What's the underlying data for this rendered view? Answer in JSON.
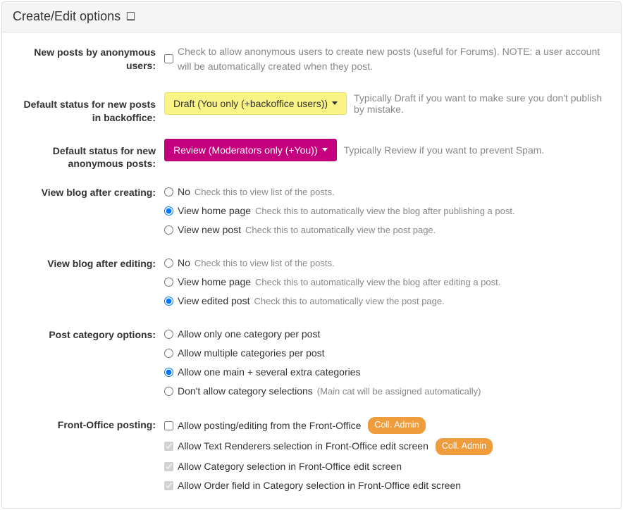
{
  "panel": {
    "title": "Create/Edit options"
  },
  "anon": {
    "label": "New posts by anonymous users:",
    "checked": false,
    "hint": "Check to allow anonymous users to create new posts (useful for Forums). NOTE: a user account will be automatically created when they post."
  },
  "backoffice_status": {
    "label": "Default status for new posts in backoffice:",
    "button": "Draft (You only (+backoffice users))",
    "hint": "Typically Draft if you want to make sure you don't publish by mistake."
  },
  "anon_status": {
    "label": "Default status for new anonymous posts:",
    "button": "Review (Moderators only (+You))",
    "hint": "Typically Review if you want to prevent Spam."
  },
  "view_create": {
    "label": "View blog after creating:",
    "opts": [
      {
        "label": "No",
        "hint": "Check this to view list of the posts.",
        "checked": false
      },
      {
        "label": "View home page",
        "hint": "Check this to automatically view the blog after publishing a post.",
        "checked": true
      },
      {
        "label": "View new post",
        "hint": "Check this to automatically view the post page.",
        "checked": false
      }
    ]
  },
  "view_edit": {
    "label": "View blog after editing:",
    "opts": [
      {
        "label": "No",
        "hint": "Check this to view list of the posts.",
        "checked": false
      },
      {
        "label": "View home page",
        "hint": "Check this to automatically view the blog after editing a post.",
        "checked": false
      },
      {
        "label": "View edited post",
        "hint": "Check this to automatically view the post page.",
        "checked": true
      }
    ]
  },
  "category": {
    "label": "Post category options:",
    "opts": [
      {
        "label": "Allow only one category per post",
        "hint": "",
        "checked": false
      },
      {
        "label": "Allow multiple categories per post",
        "hint": "",
        "checked": false
      },
      {
        "label": "Allow one main + several extra categories",
        "hint": "",
        "checked": true
      },
      {
        "label": "Don't allow category selections",
        "hint": "(Main cat will be assigned automatically)",
        "checked": false
      }
    ]
  },
  "front": {
    "label": "Front-Office posting:",
    "badge": "Coll. Admin",
    "opts": [
      {
        "label": "Allow posting/editing from the Front-Office",
        "checked": false,
        "disabled": false,
        "badge": true
      },
      {
        "label": "Allow Text Renderers selection in Front-Office edit screen",
        "checked": true,
        "disabled": true,
        "badge": true
      },
      {
        "label": "Allow Category selection in Front-Office edit screen",
        "checked": true,
        "disabled": true,
        "badge": false
      },
      {
        "label": "Allow Order field in Category selection in Front-Office edit screen",
        "checked": true,
        "disabled": true,
        "badge": false
      }
    ]
  }
}
